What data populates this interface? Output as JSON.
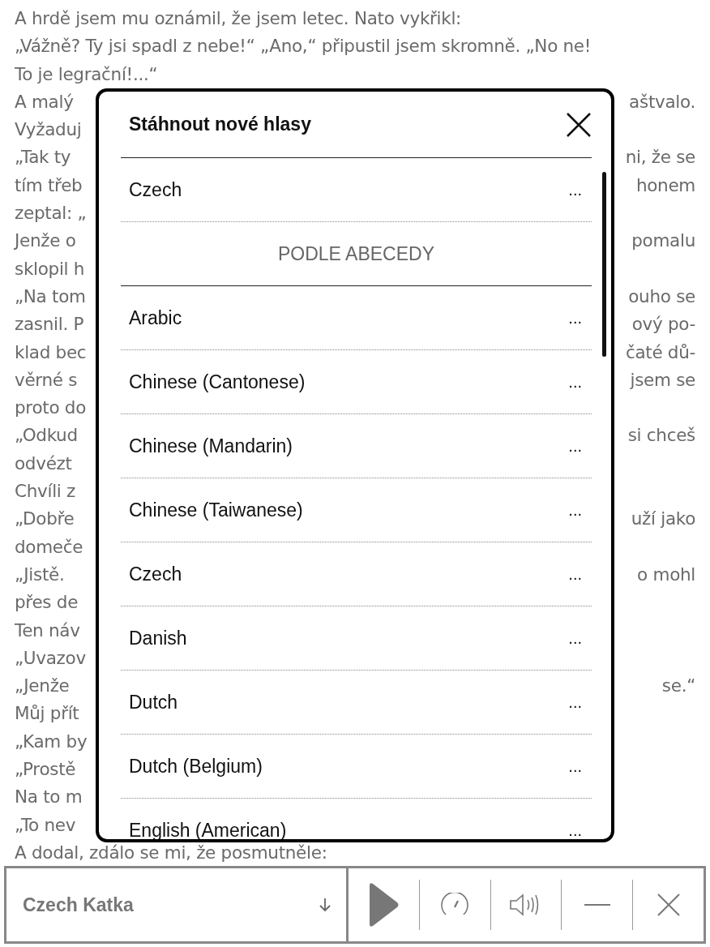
{
  "page_lines": [
    {
      "left": "A hrdě jsem mu oznámil, že jsem letec. Nato vykřikl:"
    },
    {
      "left": "„Vážně? Ty jsi spadl z nebe!“ „Ano,“ připustil jsem skromně. „No ne!"
    },
    {
      "left": "To je legrační!...“"
    },
    {
      "left": "A malý",
      "right": "aštvalo."
    },
    {
      "left": "Vyžaduj"
    },
    {
      "left": "„Tak ty",
      "right": "ni, že se"
    },
    {
      "left": "tím třeb",
      "right": "honem"
    },
    {
      "left": "zeptal: „"
    },
    {
      "left": "Jenže o",
      "right": "pomalu"
    },
    {
      "left": "sklopil h"
    },
    {
      "left": "„Na tom",
      "right": "ouho se"
    },
    {
      "left": "zasnil. P",
      "right": "ový po-"
    },
    {
      "left": "klad bec",
      "right": "čaté dů-"
    },
    {
      "left": "věrné s",
      "right": "jsem se"
    },
    {
      "left": "proto do"
    },
    {
      "left": "„Odkud",
      "right": "si chceš"
    },
    {
      "left": "odvézt"
    },
    {
      "left": "Chvíli z"
    },
    {
      "left": "„Dobře",
      "right": "uží jako"
    },
    {
      "left": "domeče"
    },
    {
      "left": "„Jistě.",
      "right": "o mohl"
    },
    {
      "left": "přes de"
    },
    {
      "left": "Ten náv"
    },
    {
      "left": "„Uvazov"
    },
    {
      "left": "„Jenže",
      "right": "se.“"
    },
    {
      "left": "Můj přít"
    },
    {
      "left": "„Kam by"
    },
    {
      "left": "„Prostě"
    },
    {
      "left": "Na to m"
    },
    {
      "left": "„To nev"
    },
    {
      "left": "A dodal, zdálo se mi, že posmutněle:"
    }
  ],
  "dialog": {
    "title": "Stáhnout nové hlasy",
    "recent_items": [
      {
        "label": "Czech",
        "menu": "..."
      }
    ],
    "section_header": "PODLE ABECEDY",
    "items": [
      {
        "label": "Arabic",
        "menu": "..."
      },
      {
        "label": "Chinese (Cantonese)",
        "menu": "..."
      },
      {
        "label": "Chinese (Mandarin)",
        "menu": "..."
      },
      {
        "label": "Chinese (Taiwanese)",
        "menu": "..."
      },
      {
        "label": "Czech",
        "menu": "..."
      },
      {
        "label": "Danish",
        "menu": "..."
      },
      {
        "label": "Dutch",
        "menu": "..."
      },
      {
        "label": "Dutch (Belgium)",
        "menu": "..."
      },
      {
        "label": "English (American)",
        "menu": "..."
      }
    ]
  },
  "player": {
    "voice": "Czech Katka"
  }
}
